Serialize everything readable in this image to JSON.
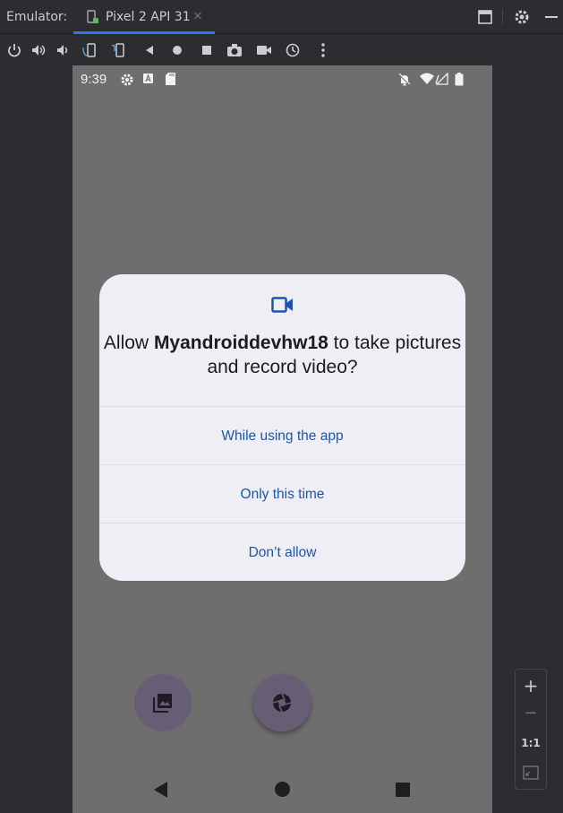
{
  "window": {
    "panel_label": "Emulator:",
    "device_tab": "Pixel 2 API 31",
    "tab_close": "×"
  },
  "status_bar": {
    "time": "9:39"
  },
  "dialog": {
    "title_prefix": "Allow ",
    "app_name": "Myandroiddevhw18",
    "title_suffix": " to take pictures and record video?",
    "options": [
      {
        "label": "While using the app"
      },
      {
        "label": "Only this time"
      },
      {
        "label": "Don’t allow"
      }
    ]
  },
  "zoom_controls": {
    "zoom_in": "+",
    "zoom_out": "−",
    "actual_size": "1:1"
  },
  "colors": {
    "accent": "#3574f0",
    "dialog_button_text": "#1d56a8",
    "scrim": "#6e6e6e",
    "dialog_bg": "#efeef4"
  }
}
